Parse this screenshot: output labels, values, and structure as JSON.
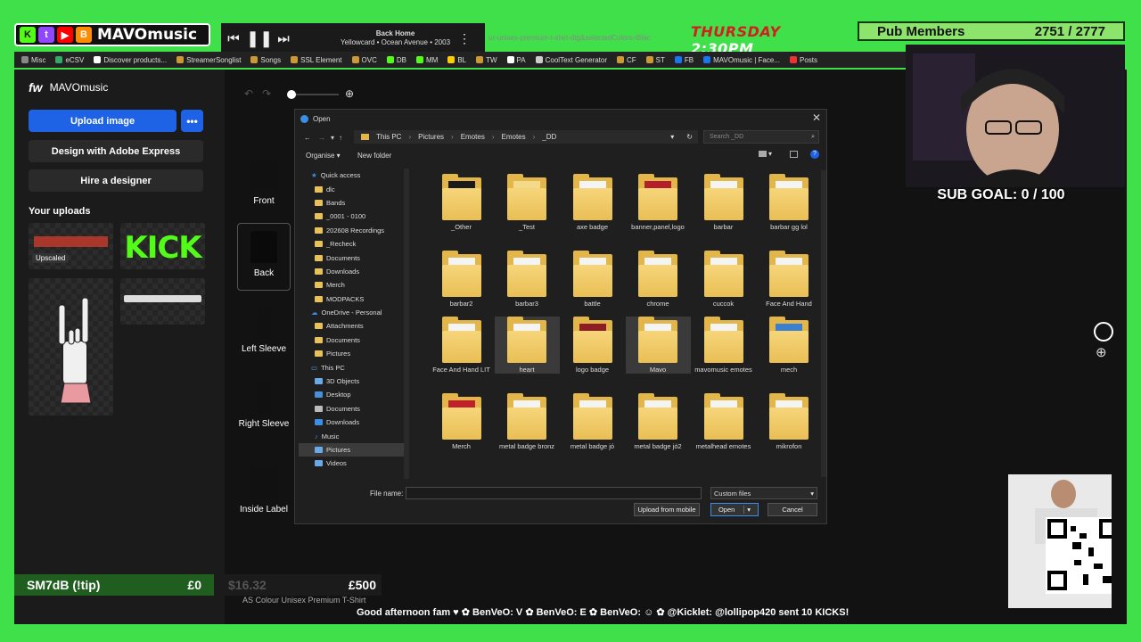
{
  "overlay": {
    "logo_text": "MAVOmusic",
    "player": {
      "title": "Back Home",
      "artist": "Yellowcard • Ocean Avenue • 2003"
    },
    "day": "THURSDAY",
    "time": "2:30PM",
    "pub_label": "Pub Members",
    "pub_count": "2751 / 2777",
    "sub_goal": "SUB GOAL: 0 / 100",
    "url_fragment": "ur-unisex-premium-t-shirt-dtg&selectedColors=Blac",
    "donation": {
      "name": "SM7dB (!tip)",
      "current": "£0",
      "mid": "$16.32",
      "goal": "£500"
    },
    "ticker": "Good afternoon fam ♥ ✿ BenVeO: V ✿ BenVeO: E ✿ BenVeO: ☺ ✿ @Kicklet: @lollipop420 sent 10 KICKS!",
    "colors": {
      "green_screen": "#3fe04a",
      "accent_blue": "#1e62e6",
      "folder": "#e2b649"
    }
  },
  "bookmarks": [
    "Misc",
    "eCSV",
    "Discover products...",
    "StreamerSonglist",
    "Songs",
    "SSL Element",
    "OVC",
    "DB",
    "MM",
    "BL",
    "TW",
    "PA",
    "CoolText Generator",
    "CF",
    "ST",
    "FB",
    "MAVOmusic | Face...",
    "Posts"
  ],
  "app": {
    "brand": "MAVOmusic",
    "upload_label": "Upload image",
    "more_label": "•••",
    "design_label": "Design with Adobe Express",
    "hire_label": "Hire a designer",
    "uploads_label": "Your uploads",
    "upscaled_label": "Upscaled",
    "kick_label": "KICK",
    "views": [
      "Front",
      "Back",
      "Left Sleeve",
      "Right Sleeve",
      "Inside Label"
    ],
    "product_name": "AS Colour Unisex Premium T-Shirt"
  },
  "dialog": {
    "title": "Open",
    "path": [
      "This PC",
      "Pictures",
      "Emotes",
      "Emotes",
      "_DD"
    ],
    "search_placeholder": "Search _DD",
    "organise": "Organise ▾",
    "new_folder": "New folder",
    "nav": [
      {
        "label": "Quick access",
        "type": "head"
      },
      {
        "label": "dlc",
        "type": "folder"
      },
      {
        "label": "Bands",
        "type": "folder"
      },
      {
        "label": "_0001 - 0100",
        "type": "folder"
      },
      {
        "label": "202608 Recordings",
        "type": "folder"
      },
      {
        "label": "_Recheck",
        "type": "folder"
      },
      {
        "label": "Documents",
        "type": "folder"
      },
      {
        "label": "Downloads",
        "type": "folder"
      },
      {
        "label": "Merch",
        "type": "folder"
      },
      {
        "label": "MODPACKS",
        "type": "folder"
      },
      {
        "label": "OneDrive - Personal",
        "type": "head"
      },
      {
        "label": "Attachments",
        "type": "folder"
      },
      {
        "label": "Documents",
        "type": "folder"
      },
      {
        "label": "Pictures",
        "type": "folder"
      },
      {
        "label": "This PC",
        "type": "head"
      },
      {
        "label": "3D Objects",
        "type": "folder"
      },
      {
        "label": "Desktop",
        "type": "folder"
      },
      {
        "label": "Documents",
        "type": "folder"
      },
      {
        "label": "Downloads",
        "type": "folder"
      },
      {
        "label": "Music",
        "type": "folder"
      },
      {
        "label": "Pictures",
        "type": "folder",
        "selected": true
      },
      {
        "label": "Videos",
        "type": "folder"
      }
    ],
    "folders": [
      "_Other",
      "_Test",
      "axe badge",
      "banner,panel,logo",
      "barbar",
      "barbar gg lol",
      "barbar2",
      "barbar3",
      "battle",
      "chrome",
      "cuccok",
      "Face And Hand",
      "Face And Hand LIT",
      "heart",
      "logo badge",
      "Mavo",
      "mavomusic emotes",
      "mech",
      "Merch",
      "metal badge bronz",
      "metal badge jó",
      "metal badge jó2",
      "metalhead emotes",
      "mikrofon"
    ],
    "file_name_label": "File name:",
    "file_type": "Custom files",
    "upload_mobile": "Upload from mobile",
    "open_label": "Open",
    "cancel_label": "Cancel"
  }
}
